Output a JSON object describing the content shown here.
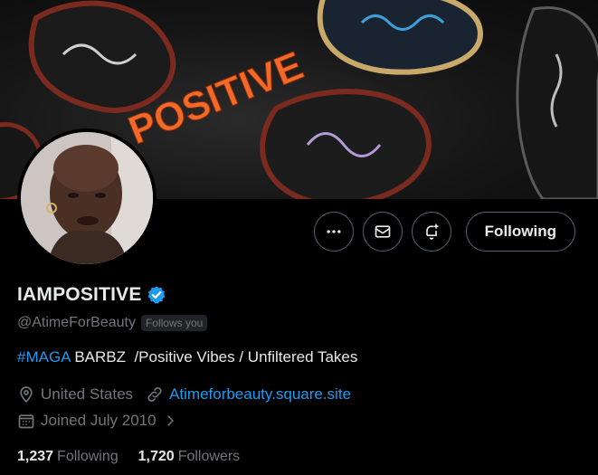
{
  "banner": {
    "text": "POSITIVE",
    "text_color": "#f26a2a"
  },
  "profile": {
    "name": "IAMPOSITIVE",
    "handle": "@AtimeForBeauty",
    "follows_you": "Follows you",
    "bio_hashtag": "#MAGA",
    "bio_rest": " BARBZ  /Positive Vibes / Unfiltered Takes",
    "location": "United States",
    "website": "Atimeforbeauty.square.site",
    "joined": "Joined July 2010"
  },
  "actions": {
    "follow_label": "Following"
  },
  "stats": {
    "following_count": "1,237",
    "following_label": "Following",
    "followers_count": "1,720",
    "followers_label": "Followers"
  },
  "icons": {
    "more": "more-icon",
    "message": "envelope-icon",
    "notify": "bell-plus-icon",
    "verified": "verified-badge-icon",
    "location": "location-pin-icon",
    "link": "link-icon",
    "calendar": "calendar-icon",
    "chevron": "chevron-right-icon"
  },
  "colors": {
    "accent": "#1d9bf0",
    "muted": "#71767b",
    "text": "#e7e9ea",
    "background": "#000000"
  }
}
